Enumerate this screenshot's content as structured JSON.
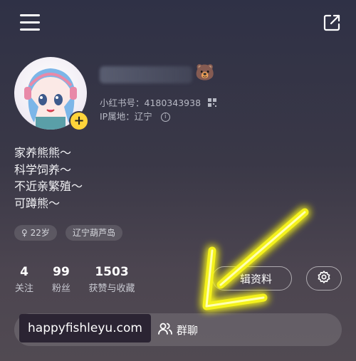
{
  "profile": {
    "id_label": "小红书号：4180343938",
    "ip_label": "IP属地：辽宁",
    "bio": [
      "家养熊熊～",
      "科学饲养～",
      "不近亲繁殖～",
      "可蹲熊～"
    ],
    "tags": [
      "♀ 22岁",
      "辽宁葫芦岛"
    ]
  },
  "stats": [
    {
      "num": "4",
      "label": "关注"
    },
    {
      "num": "99",
      "label": "粉丝"
    },
    {
      "num": "1503",
      "label": "获赞与收藏"
    }
  ],
  "buttons": {
    "edit_label": "辑资料"
  },
  "bottom": {
    "watermark": "happyfishleyu.com",
    "group_label": "群聊"
  },
  "icons": {
    "bear": "🐻",
    "info": "i",
    "add": "+"
  },
  "colors": {
    "accent_yellow": "#ffd43a",
    "arrow_yellow": "#f4f21e"
  }
}
